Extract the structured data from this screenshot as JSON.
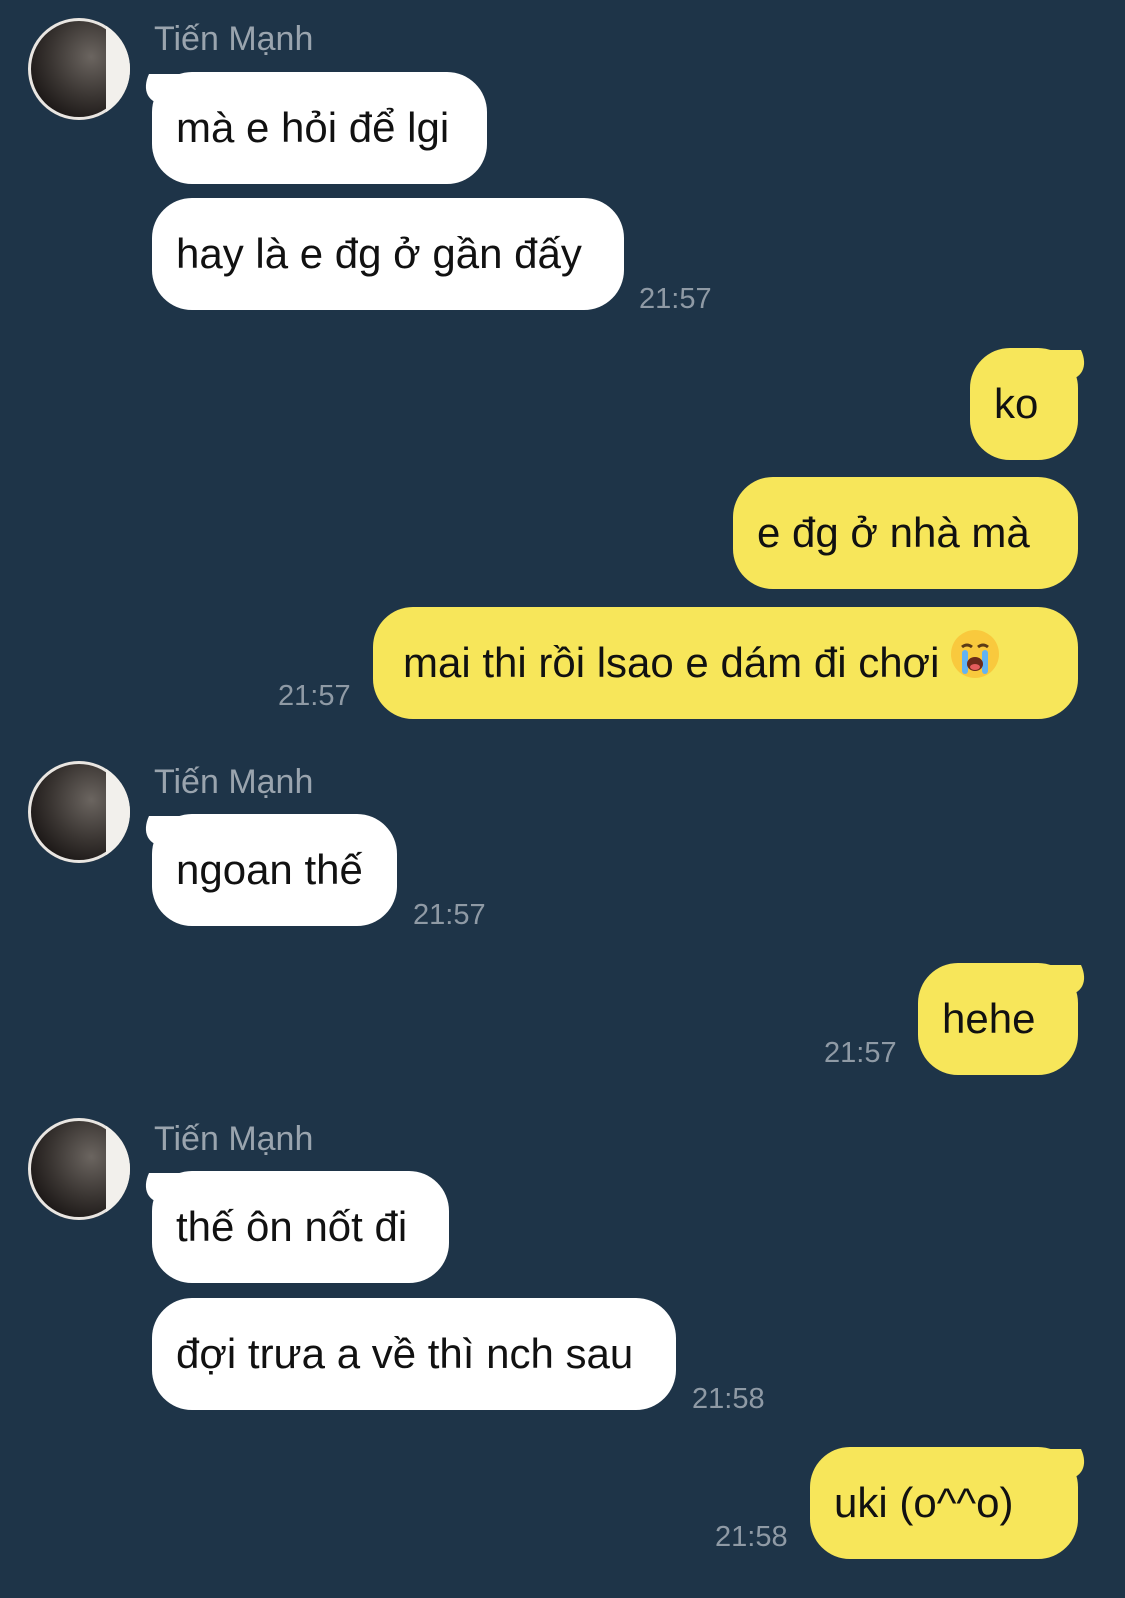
{
  "contact": {
    "name": "Tiến Mạnh"
  },
  "colors": {
    "background": "#1e3448",
    "incoming": "#ffffff",
    "outgoing": "#f7e65a",
    "timestamp": "#8f9aa5"
  },
  "messages": {
    "m1": {
      "text": "mà e hỏi để lgi"
    },
    "m2": {
      "text": "hay là e đg ở gần đấy",
      "time": "21:57"
    },
    "m3": {
      "text": "ko"
    },
    "m4": {
      "text": "e đg ở nhà mà"
    },
    "m5": {
      "text": "mai thi rồi lsao e dám đi chơi",
      "emoji": "loudly-crying-face-icon",
      "time": "21:57"
    },
    "m6": {
      "text": "ngoan thế",
      "time": "21:57"
    },
    "m7": {
      "text": "hehe",
      "time": "21:57"
    },
    "m8": {
      "text": "thế ôn nốt đi"
    },
    "m9": {
      "text": "đợi trưa a về thì nch sau",
      "time": "21:58"
    },
    "m10": {
      "text": "uki (o^^o)",
      "time": "21:58"
    }
  }
}
